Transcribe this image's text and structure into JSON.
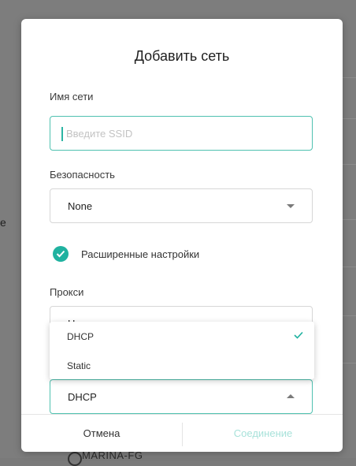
{
  "background": {
    "left_glyph": "e",
    "peek_text": "MARINA-FG"
  },
  "dialog": {
    "title": "Добавить сеть",
    "ssid": {
      "label": "Имя сети",
      "placeholder": "Введите SSID",
      "value": ""
    },
    "security": {
      "label": "Безопасность",
      "selected": "None"
    },
    "advanced": {
      "checked": true,
      "label": "Расширенные настройки"
    },
    "proxy": {
      "label": "Прокси",
      "selected": "Нет"
    },
    "ip_settings": {
      "selected": "DHCP",
      "options": [
        {
          "label": "DHCP",
          "selected": true
        },
        {
          "label": "Static",
          "selected": false
        }
      ]
    },
    "buttons": {
      "cancel": "Отмена",
      "connect": "Соединение"
    }
  },
  "colors": {
    "accent": "#20b2a0",
    "accent_border": "#4fc1b0",
    "disabled_text": "#a8e2da",
    "scrim": "#7d7d7d"
  }
}
